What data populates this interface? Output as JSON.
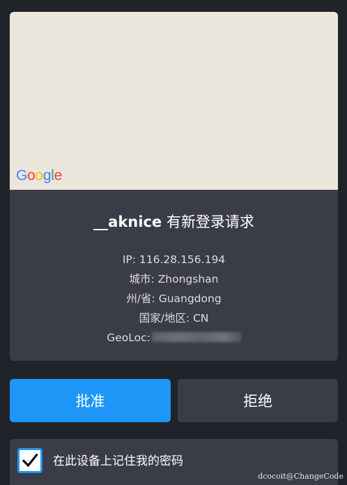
{
  "map": {
    "attribution_letters": [
      "G",
      "o",
      "o",
      "g",
      "l",
      "e"
    ]
  },
  "request": {
    "username": "__aknice",
    "title_suffix": " 有新登录请求"
  },
  "details": {
    "ip_label": "IP: ",
    "ip_value": "116.28.156.194",
    "city_label": "城市: ",
    "city_value": "Zhongshan",
    "province_label": "州/省: ",
    "province_value": "Guangdong",
    "country_label": "国家/地区: ",
    "country_value": "CN",
    "geoloc_label": "GeoLoc:"
  },
  "actions": {
    "approve_label": "批准",
    "reject_label": "拒绝"
  },
  "remember": {
    "label": "在此设备上记住我的密码",
    "checked": true
  },
  "watermark": {
    "text": "dcocoit@ChangeCode"
  },
  "colors": {
    "background": "#21232a",
    "panel": "#3a3c48",
    "map": "#ebe7dd",
    "accent": "#1e96f7"
  }
}
